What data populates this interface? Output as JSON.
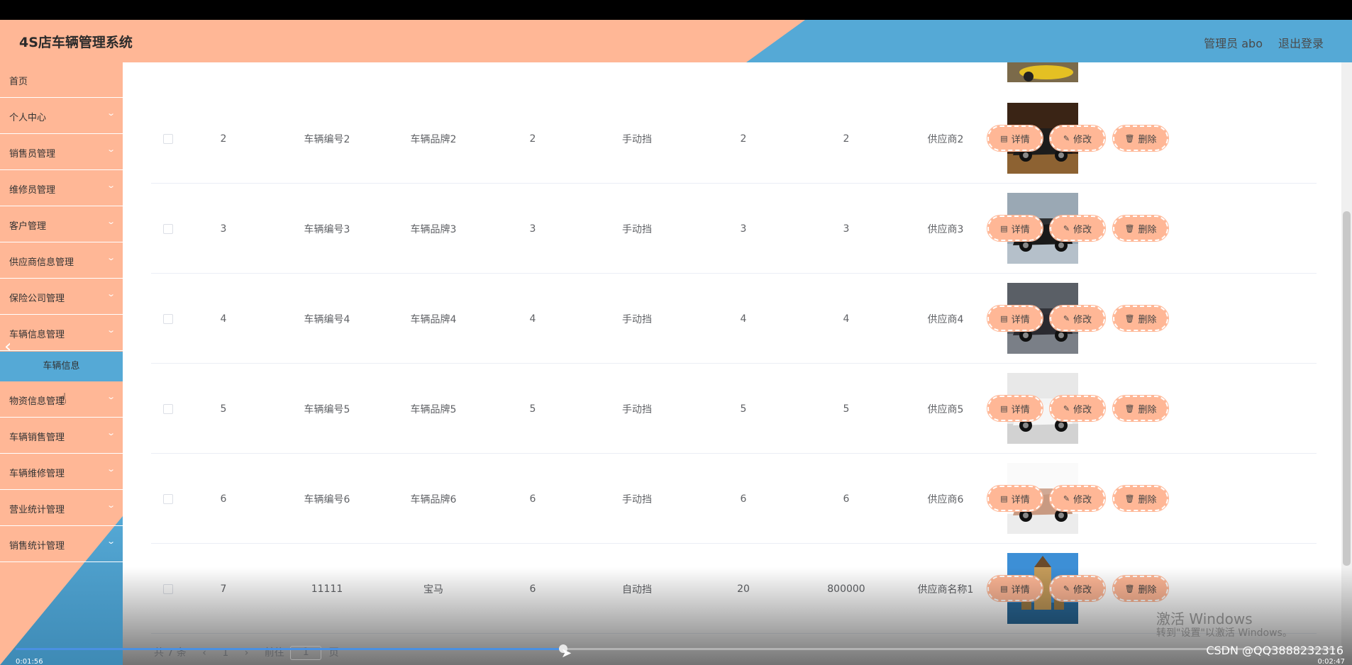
{
  "header": {
    "title": "4S店车辆管理系统",
    "user": "管理员 abo",
    "logout": "退出登录"
  },
  "sidebar": {
    "items": [
      {
        "label": "首页",
        "chevron": false
      },
      {
        "label": "个人中心",
        "chevron": true
      },
      {
        "label": "销售员管理",
        "chevron": true
      },
      {
        "label": "维修员管理",
        "chevron": true
      },
      {
        "label": "客户管理",
        "chevron": true
      },
      {
        "label": "供应商信息管理",
        "chevron": true
      },
      {
        "label": "保险公司管理",
        "chevron": true
      },
      {
        "label": "车辆信息管理",
        "chevron": true
      },
      {
        "label": "物资信息管理",
        "chevron": true
      },
      {
        "label": "车辆销售管理",
        "chevron": true
      },
      {
        "label": "车辆维修管理",
        "chevron": true
      },
      {
        "label": "营业统计管理",
        "chevron": true
      },
      {
        "label": "销售统计管理",
        "chevron": true
      }
    ],
    "active_sub": "车辆信息"
  },
  "table": {
    "rows": [
      {
        "index": "2",
        "code": "车辆编号2",
        "brand": "车辆品牌2",
        "c4": "2",
        "gear": "手动挡",
        "c6": "2",
        "price": "2",
        "supplier": "供应商2",
        "image": "car-black-sports-night"
      },
      {
        "index": "3",
        "code": "车辆编号3",
        "brand": "车辆品牌3",
        "c4": "3",
        "gear": "手动挡",
        "c6": "3",
        "price": "3",
        "supplier": "供应商3",
        "image": "car-black-suv"
      },
      {
        "index": "4",
        "code": "车辆编号4",
        "brand": "车辆品牌4",
        "c4": "4",
        "gear": "手动挡",
        "c6": "4",
        "price": "4",
        "supplier": "供应商4",
        "image": "car-dark-suv"
      },
      {
        "index": "5",
        "code": "车辆编号5",
        "brand": "车辆品牌5",
        "c4": "5",
        "gear": "手动挡",
        "c6": "5",
        "price": "5",
        "supplier": "供应商5",
        "image": "car-white-roadster"
      },
      {
        "index": "6",
        "code": "车辆编号6",
        "brand": "车辆品牌6",
        "c4": "6",
        "gear": "手动挡",
        "c6": "6",
        "price": "6",
        "supplier": "供应商6",
        "image": "car-bronze-coupe"
      },
      {
        "index": "7",
        "code": "11111",
        "brand": "宝马",
        "c4": "6",
        "gear": "自动挡",
        "c6": "20",
        "price": "800000",
        "supplier": "供应商名称1",
        "image": "castle-landscape"
      }
    ],
    "actions": {
      "detail": "详情",
      "edit": "修改",
      "delete": "删除"
    }
  },
  "pager": {
    "total": "共 7 条",
    "page": "1",
    "goto": "前往",
    "page_unit": "页"
  },
  "video": {
    "time_current": "0:01:56",
    "time_total": "0:02:47",
    "progress": 0.415
  },
  "watermark": {
    "line1": "激活 Windows",
    "line2": "转到\"设置\"以激活 Windows。",
    "csdn": "CSDN @QQ3888232316"
  },
  "colors": {
    "peach": "#ffb796",
    "blue": "#55a9d6"
  }
}
